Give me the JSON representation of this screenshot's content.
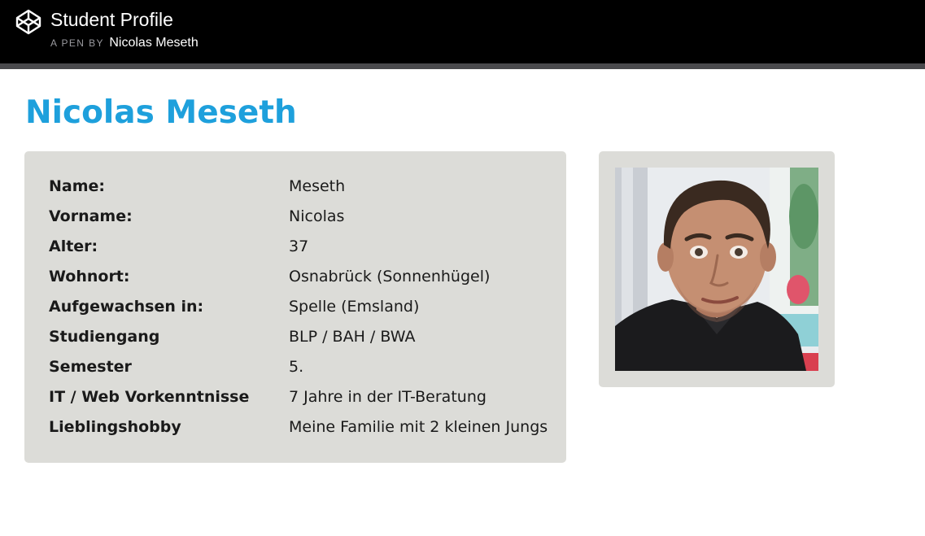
{
  "header": {
    "title": "Student Profile",
    "byline_prefix": "A PEN BY",
    "author": "Nicolas Meseth",
    "logo_icon": "codepen-logo-icon"
  },
  "main": {
    "heading": "Nicolas Meseth",
    "heading_color": "#1ea0dc",
    "card_color": "#dcdcd8",
    "profile": [
      {
        "label": "Name:",
        "value": "Meseth"
      },
      {
        "label": "Vorname:",
        "value": "Nicolas"
      },
      {
        "label": "Alter:",
        "value": "37"
      },
      {
        "label": "Wohnort:",
        "value": "Osnabrück (Sonnenhügel)"
      },
      {
        "label": "Aufgewachsen in:",
        "value": "Spelle (Emsland)"
      },
      {
        "label": "Studiengang",
        "value": "BLP / BAH / BWA"
      },
      {
        "label": "Semester",
        "value": "5."
      },
      {
        "label": "IT / Web Vorkenntnisse",
        "value": "7 Jahre in der IT-Beratung"
      },
      {
        "label": "Lieblingshobby",
        "value": "Meine Familie mit 2 kleinen Jungs"
      }
    ],
    "photo_icon": "profile-photo"
  }
}
